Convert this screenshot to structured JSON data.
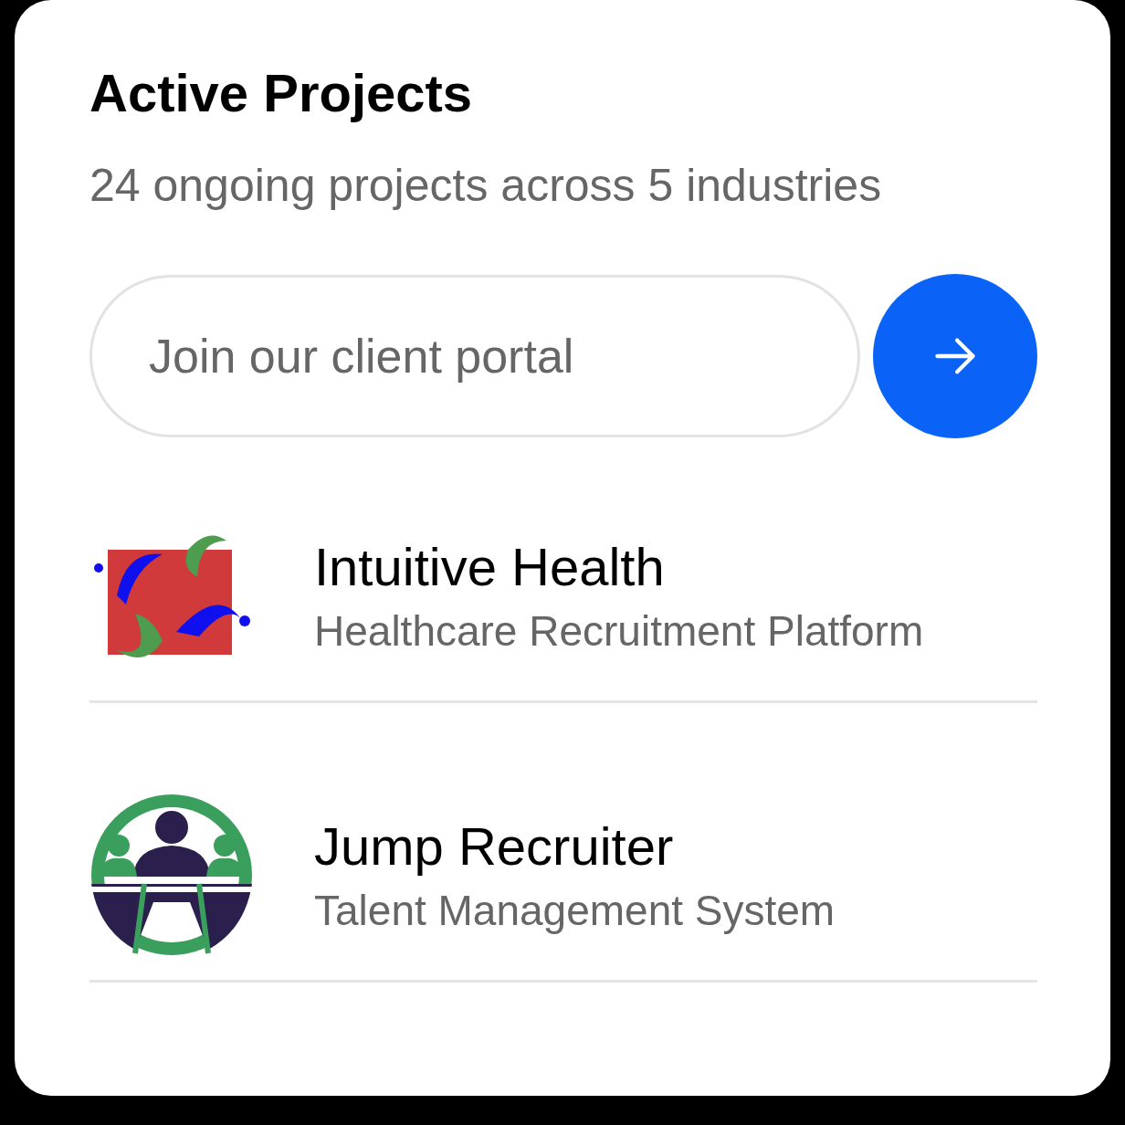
{
  "card": {
    "title": "Active Projects",
    "subtitle": "24 ongoing projects across 5 industries"
  },
  "signup": {
    "placeholder": "Join our client portal"
  },
  "projects": [
    {
      "name": "Intuitive Health",
      "description": "Healthcare Recruitment Platform"
    },
    {
      "name": "Jump Recruiter",
      "description": "Talent Management System"
    }
  ]
}
